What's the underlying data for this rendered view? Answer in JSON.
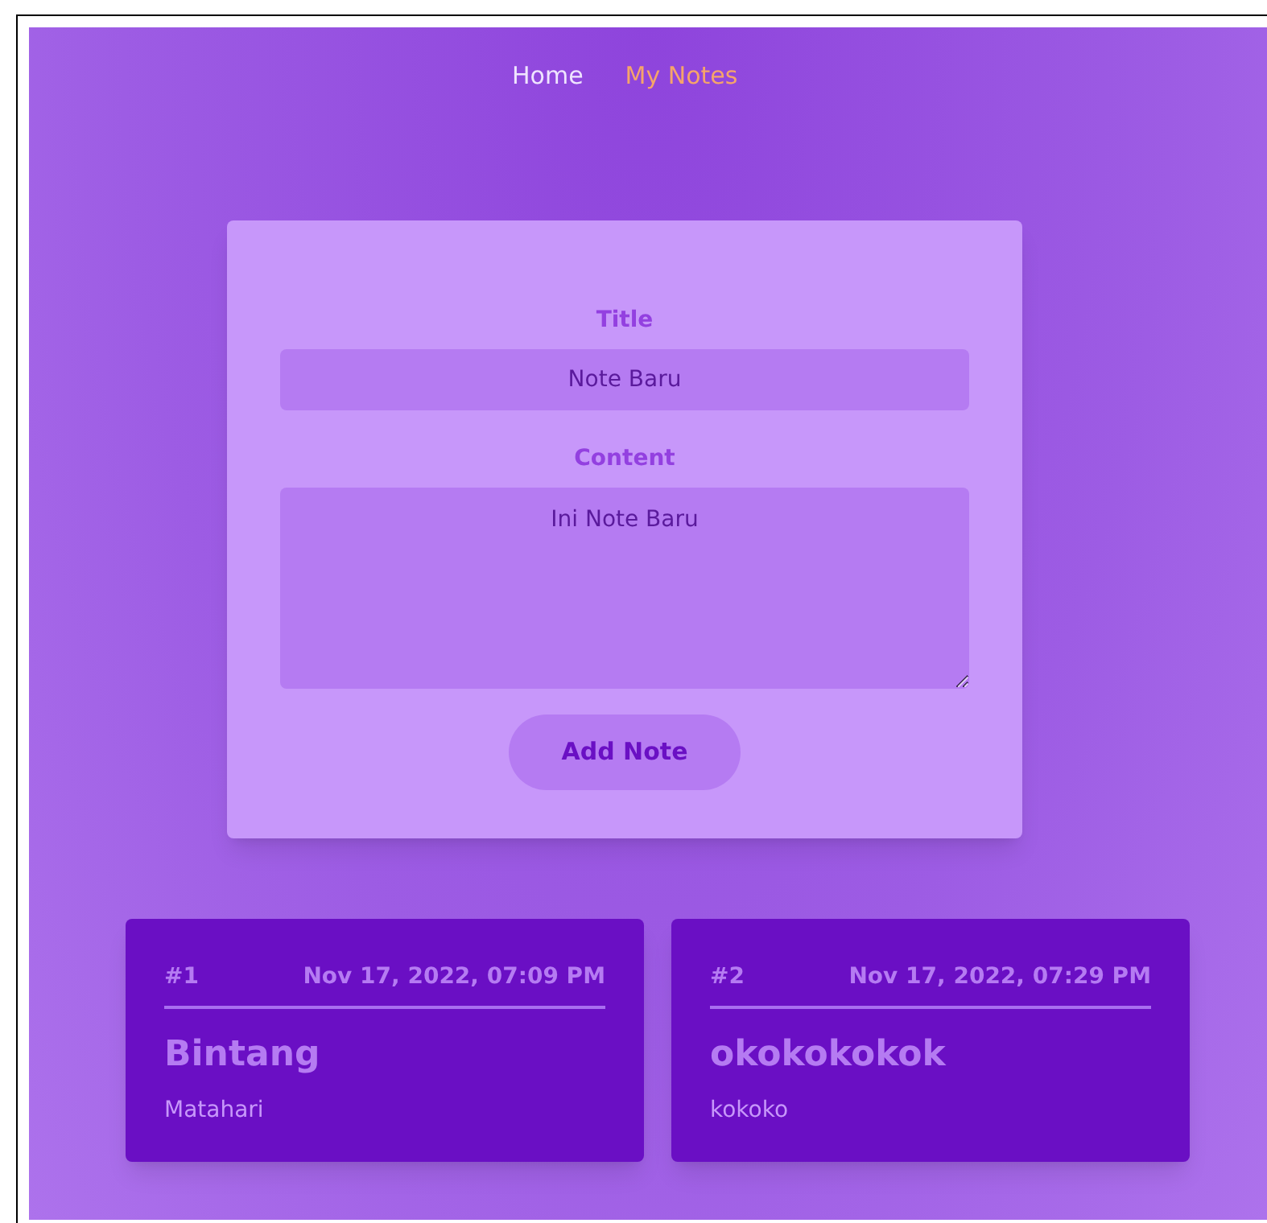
{
  "nav": [
    {
      "label": "Home",
      "selected": false
    },
    {
      "label": "My Notes",
      "selected": true
    }
  ],
  "form": {
    "title": {
      "label": "Title",
      "value": "Note Baru"
    },
    "content": {
      "label": "Content",
      "value": "Ini Note Baru"
    },
    "submit": "Add Note"
  },
  "notes": [
    {
      "number": "#1",
      "date": "Nov 17, 2022, 07:09 PM",
      "title": "Bintang",
      "body": "Matahari"
    },
    {
      "number": "#2",
      "date": "Nov 17, 2022, 07:29 PM",
      "title": "okokokokok",
      "body": "kokoko"
    }
  ]
}
